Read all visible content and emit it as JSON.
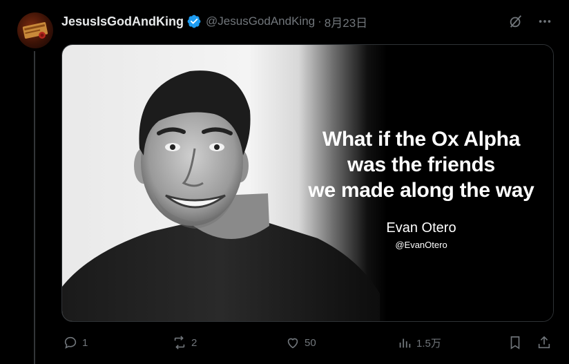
{
  "tweet": {
    "display_name": "JesusIsGodAndKing",
    "handle": "@JesusGodAndKing",
    "separator": "·",
    "date": "8月23日",
    "avatar_icon": "scroll-seal-avatar",
    "verified_icon": "verified-badge-icon",
    "header_icons": [
      "grok-icon",
      "more-icon"
    ]
  },
  "media": {
    "quote_lines": [
      "What if the Ox Alpha",
      "was the friends",
      "we made along the way"
    ],
    "author_name": "Evan Otero",
    "author_handle": "@EvanOtero"
  },
  "actions": {
    "reply": {
      "icon": "reply-icon",
      "count": "1"
    },
    "retweet": {
      "icon": "retweet-icon",
      "count": "2"
    },
    "like": {
      "icon": "heart-icon",
      "count": "50"
    },
    "views": {
      "icon": "views-icon",
      "count": "1.5万"
    },
    "bookmark": {
      "icon": "bookmark-icon"
    },
    "share": {
      "icon": "share-icon"
    }
  },
  "colors": {
    "background": "#000000",
    "text": "#e7e9ea",
    "muted": "#71767b",
    "verified": "#1d9bf0",
    "border": "#2f3336"
  }
}
